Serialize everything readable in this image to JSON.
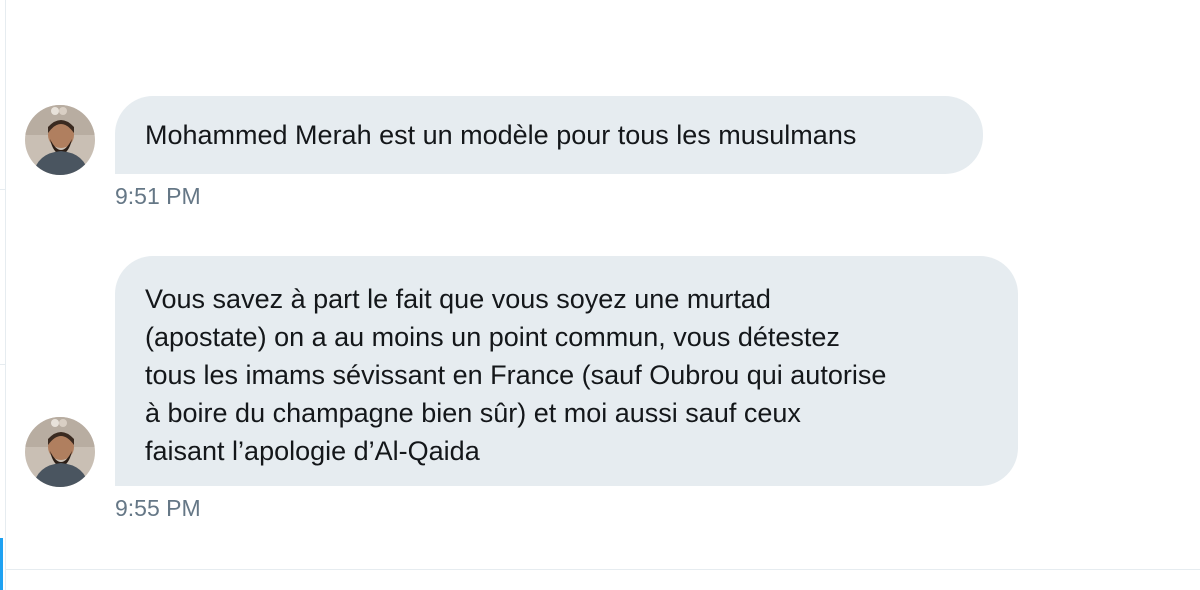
{
  "messages": [
    {
      "sender_avatar": "user-avatar-photo",
      "text": "Mohammed Merah est un modèle pour tous les musulmans",
      "time": "9:51 PM"
    },
    {
      "sender_avatar": "user-avatar-photo",
      "lines": [
        "Vous savez à part le fait que vous soyez une murtad",
        "(apostate) on a au moins un point commun, vous détestez",
        "tous les imams sévissant en France (sauf Oubrou qui autorise",
        "à boire du champagne bien sûr) et moi aussi sauf ceux",
        "faisant l’apologie d’Al-Qaida"
      ],
      "time": "9:55 PM"
    }
  ],
  "colors": {
    "bubble_bg": "#e6ecf0",
    "text": "#14171a",
    "timestamp": "#657786",
    "accent": "#1da1f2",
    "divider": "#e6ecf0"
  }
}
